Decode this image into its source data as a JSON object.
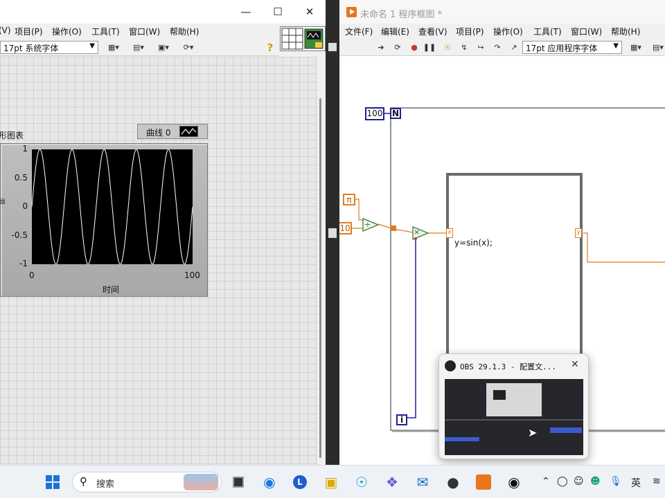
{
  "front_panel": {
    "menu": [
      "(V)",
      "项目(P)",
      "操作(O)",
      "工具(T)",
      "窗口(W)",
      "帮助(H)"
    ],
    "font_select": "17pt 系统字体",
    "help_icon": "?",
    "graph": {
      "label": "形图表",
      "legend_name": "曲线 0",
      "y_ticks": [
        "1",
        "0.5",
        "0",
        "-0.5",
        "-1"
      ],
      "x_ticks": [
        "0",
        "100"
      ],
      "x_label": "时间"
    }
  },
  "block_diagram": {
    "title": "未命名 1 程序框图 *",
    "menu": [
      "文件(F)",
      "编辑(E)",
      "查看(V)",
      "项目(P)",
      "操作(O)",
      "工具(T)",
      "窗口(W)",
      "帮助(H)"
    ],
    "font_select": "17pt 应用程序字体",
    "loop_count": "100",
    "loop_n": "N",
    "loop_i": "i",
    "pi_const": "π",
    "ten_const": "10",
    "divide_glyph": "÷",
    "multiply_glyph": "×",
    "formula_text": "y=sin(x);",
    "tunnel_x": "x",
    "tunnel_y": "y"
  },
  "obs_popup": {
    "title": "OBS 29.1.3 - 配置文..."
  },
  "taskbar": {
    "search_label": "搜索",
    "ime": "英"
  },
  "chart_data": {
    "type": "line",
    "title": "",
    "xlabel": "时间",
    "ylabel": "",
    "xlim": [
      0,
      100
    ],
    "ylim": [
      -1,
      1
    ],
    "series": [
      {
        "color": "#ffffff",
        "function": "sin(2*pi*i/20)",
        "x_range": [
          0,
          100
        ],
        "cycles": 5
      }
    ]
  }
}
